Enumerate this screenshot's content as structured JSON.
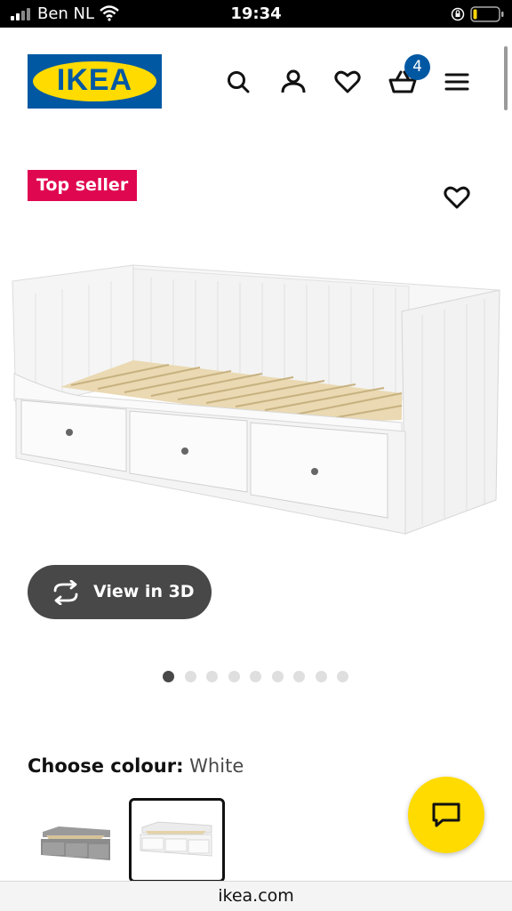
{
  "status_bar": {
    "carrier": "Ben NL",
    "time": "19:34",
    "icons": [
      "signal-icon",
      "wifi-icon",
      "orientation-lock-icon",
      "battery-icon"
    ]
  },
  "header": {
    "logo_text": "IKEA",
    "icons": [
      "search-icon",
      "account-icon",
      "favourites-icon",
      "cart-icon",
      "menu-icon"
    ],
    "cart_count": "4"
  },
  "product": {
    "badge": "Top seller",
    "image": "daybed-with-drawers-image",
    "view_3d_label": "View in 3D",
    "carousel": {
      "total": 9,
      "active_index": 0
    },
    "colour": {
      "label": "Choose colour:",
      "value": "White",
      "swatches": [
        {
          "name": "grey",
          "selected": false
        },
        {
          "name": "white",
          "selected": true
        }
      ]
    }
  },
  "browser": {
    "url": "ikea.com"
  },
  "colors": {
    "ikea_blue": "#0058a3",
    "ikea_yellow": "#ffdb00",
    "badge_red": "#e00751",
    "dark_grey": "#484848"
  }
}
